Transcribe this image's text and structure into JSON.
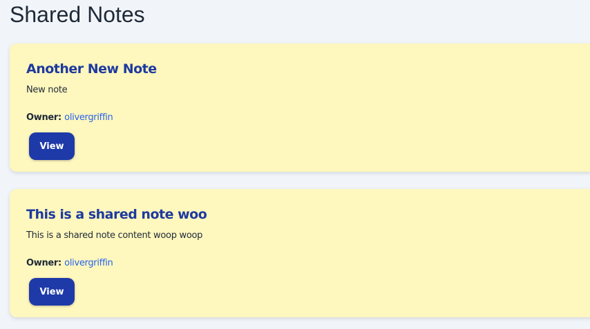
{
  "page": {
    "title": "Shared Notes"
  },
  "notes": [
    {
      "title": "Another New Note",
      "content": "New note",
      "owner_label": "Owner:",
      "owner": "olivergriffin",
      "button_label": "View"
    },
    {
      "title": "This is a shared note woo",
      "content": "This is a shared note content woop woop",
      "owner_label": "Owner:",
      "owner": "olivergriffin",
      "button_label": "View"
    }
  ],
  "colors": {
    "background": "#f1f5f9",
    "card_background": "#fef7be",
    "title_color": "#1e3a9e",
    "link_color": "#2563eb",
    "button_color": "#1e3aa8"
  }
}
